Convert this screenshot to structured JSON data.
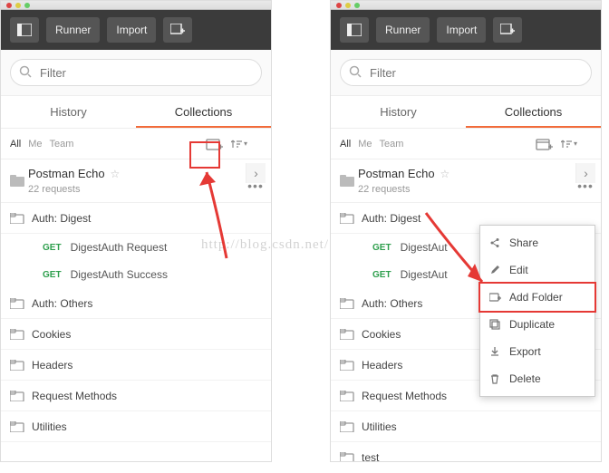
{
  "header": {
    "runner": "Runner",
    "import": "Import"
  },
  "search": {
    "placeholder": "Filter"
  },
  "tabs": {
    "history": "History",
    "collections": "Collections"
  },
  "filters": {
    "all": "All",
    "me": "Me",
    "team": "Team"
  },
  "collection": {
    "name": "Postman Echo",
    "sub": "22 requests"
  },
  "folders": {
    "digest": "Auth: Digest",
    "others": "Auth: Others",
    "cookies": "Cookies",
    "headers": "Headers",
    "methods": "Request Methods",
    "utilities": "Utilities",
    "test": "test"
  },
  "requests": {
    "method": "GET",
    "r1": "DigestAuth Request",
    "r2": "DigestAuth Success",
    "r1short": "DigestAut",
    "r2short": "DigestAut"
  },
  "menu": {
    "share": "Share",
    "edit": "Edit",
    "addfolder": "Add Folder",
    "duplicate": "Duplicate",
    "export": "Export",
    "delete": "Delete"
  },
  "watermark": "http://blog.csdn.net/"
}
